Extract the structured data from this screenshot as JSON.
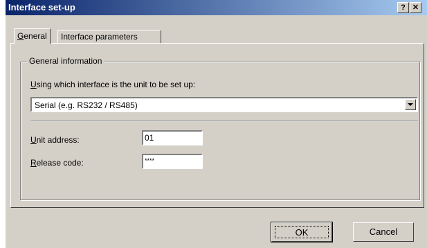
{
  "window": {
    "title": "Interface set-up",
    "help_button": "?",
    "close_button": "✕"
  },
  "tabs": [
    {
      "label": "General",
      "accel": "G",
      "rest": "eneral",
      "active": true
    },
    {
      "label": "Interface parameters",
      "active": false
    }
  ],
  "general": {
    "group_title": "General information",
    "interface_label_accel": "U",
    "interface_label_rest": "sing which interface is the unit to be set up:",
    "interface_value": "Serial (e.g. RS232 / RS485)",
    "unit_address_label_accel": "U",
    "unit_address_label_rest": "nit address:",
    "unit_address_value": "01",
    "release_code_label_accel": "R",
    "release_code_label_rest": "elease code:",
    "release_code_value": "****"
  },
  "buttons": {
    "ok": "OK",
    "cancel": "Cancel"
  }
}
